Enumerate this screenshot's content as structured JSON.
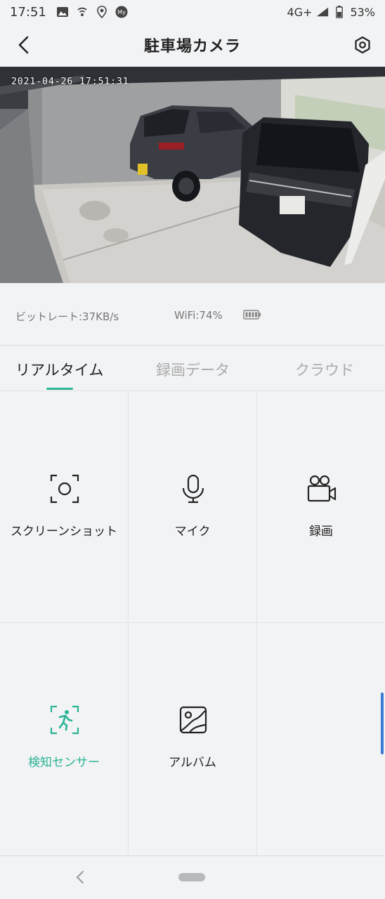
{
  "status_bar": {
    "time": "17:51",
    "network": "4G+",
    "battery": "53%",
    "icons": [
      "photo-icon",
      "wifi-calling-icon",
      "location-icon",
      "my-app-icon"
    ]
  },
  "header": {
    "title": "駐車場カメラ",
    "back_icon": "chevron-left-icon",
    "settings_icon": "hexagon-settings-icon"
  },
  "video": {
    "timestamp": "2021-04-26 17:51:31"
  },
  "info": {
    "bitrate": "ビットレート:37KB/s",
    "wifi": "WiFi:74%"
  },
  "tabs": [
    {
      "label": "リアルタイム",
      "active": true
    },
    {
      "label": "録画データ",
      "active": false
    },
    {
      "label": "クラウド",
      "active": false
    }
  ],
  "actions": [
    {
      "label": "スクリーンショット",
      "icon": "screenshot-icon"
    },
    {
      "label": "マイク",
      "icon": "microphone-icon"
    },
    {
      "label": "録画",
      "icon": "video-camera-icon"
    },
    {
      "label": "検知センサー",
      "icon": "motion-detect-icon",
      "highlight": true
    },
    {
      "label": "アルバム",
      "icon": "album-icon"
    }
  ],
  "colors": {
    "accent": "#2bb596",
    "background": "#f2f3f5"
  }
}
